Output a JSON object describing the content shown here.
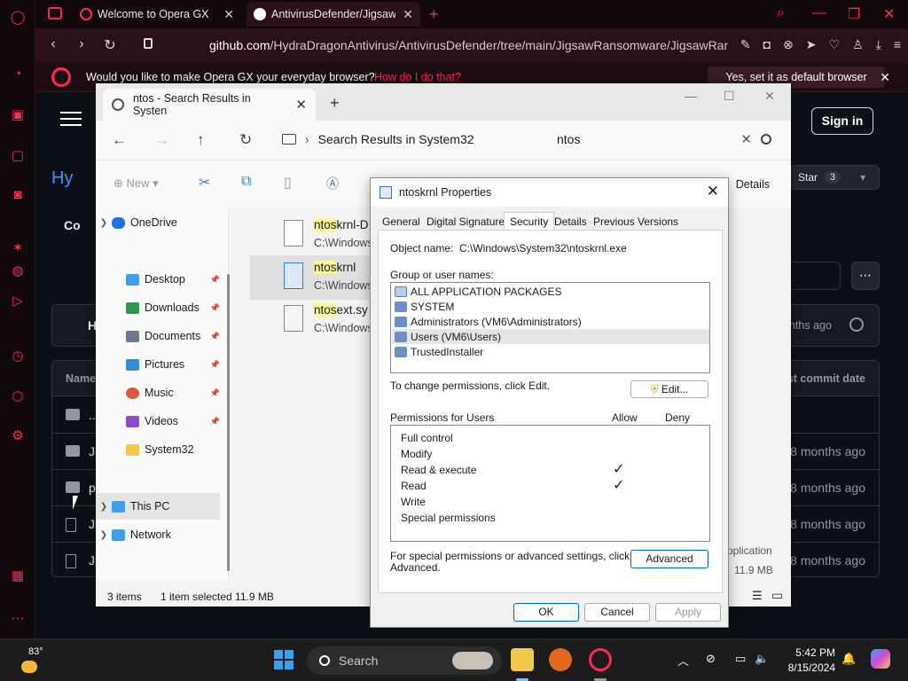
{
  "browser": {
    "tabs": [
      {
        "label": "Welcome to Opera GX"
      },
      {
        "label": "AntivirusDefender/JigsawR"
      }
    ],
    "url_host": "github.com",
    "url_path": "/HydraDragonAntivirus/AntivirusDefender/tree/main/JigsawRansomware/JigsawRansomwa",
    "infobar": {
      "question": "Would you like to make Opera GX your everyday browser?",
      "how_link": "How do I do that?",
      "set_default": "Yes, set it as default browser"
    },
    "accent_color": "#ff2a4f"
  },
  "github": {
    "sign_in": "Sign in",
    "repo_title_visible": "Hy",
    "code_tab_visible": "Co",
    "star_label": "Star",
    "star_count": "3",
    "commit_author_visible": "H",
    "commit_ago": "nths ago",
    "table_header_name": "Name",
    "table_header_date": "ast commit date",
    "rows": [
      {
        "name": "..",
        "age": ""
      },
      {
        "name": "Ji",
        "age": "8 months ago"
      },
      {
        "name": "p",
        "age": "8 months ago"
      },
      {
        "name": "Ji",
        "age": "8 months ago"
      },
      {
        "name": "Ji",
        "age": "8 months ago"
      }
    ]
  },
  "explorer": {
    "tab_title": "ntos - Search Results in Systen",
    "breadcrumb": "Search Results in System32",
    "search_value": "ntos",
    "toolbar_new": "New",
    "toolbar_details": "Details",
    "sidebar": [
      {
        "label": "OneDrive",
        "color": "#1a73e8"
      },
      {
        "label": "Desktop",
        "color": "#3aa0f3"
      },
      {
        "label": "Downloads",
        "color": "#2d9a4b"
      },
      {
        "label": "Documents",
        "color": "#6b7a90"
      },
      {
        "label": "Pictures",
        "color": "#2f8ed8"
      },
      {
        "label": "Music",
        "color": "#e0553a"
      },
      {
        "label": "Videos",
        "color": "#8a4bd1"
      },
      {
        "label": "System32",
        "color": "#f2c94c"
      },
      {
        "label": "This PC",
        "color": "#3aa0f3"
      },
      {
        "label": "Network",
        "color": "#3aa0f3"
      }
    ],
    "files": [
      {
        "highlight": "ntos",
        "rest": "krnl-D",
        "path": "C:\\Windows"
      },
      {
        "highlight": "ntos",
        "rest": "krnl",
        "path": "C:\\Windows"
      },
      {
        "highlight": "ntos",
        "rest": "ext.sy",
        "path": "C:\\Windows"
      }
    ],
    "status_items": "3 items",
    "status_selected": "1 item selected  11.9 MB",
    "right_type": "pplication",
    "right_size": "11.9 MB"
  },
  "properties": {
    "title": "ntoskrnl Properties",
    "tabs": [
      "General",
      "Digital Signatures",
      "Security",
      "Details",
      "Previous Versions"
    ],
    "object_name_label": "Object name:",
    "object_name_value": "C:\\Windows\\System32\\ntoskrnl.exe",
    "group_label": "Group or user names:",
    "groups": [
      "ALL APPLICATION PACKAGES",
      "SYSTEM",
      "Administrators (VM6\\Administrators)",
      "Users (VM6\\Users)",
      "TrustedInstaller"
    ],
    "change_perm_text": "To change permissions, click Edit.",
    "edit_button": "Edit...",
    "perm_for_label": "Permissions for Users",
    "allow_label": "Allow",
    "deny_label": "Deny",
    "permissions": [
      {
        "name": "Full control",
        "allow": ""
      },
      {
        "name": "Modify",
        "allow": ""
      },
      {
        "name": "Read & execute",
        "allow": "✓"
      },
      {
        "name": "Read",
        "allow": "✓"
      },
      {
        "name": "Write",
        "allow": ""
      },
      {
        "name": "Special permissions",
        "allow": ""
      }
    ],
    "advanced_text_line1": "For special permissions or advanced settings, click",
    "advanced_text_line2": "Advanced.",
    "advanced_button": "Advanced",
    "ok_button": "OK",
    "cancel_button": "Cancel",
    "apply_button": "Apply"
  },
  "taskbar": {
    "temperature": "83°",
    "search_label": "Search",
    "time": "5:42 PM",
    "date": "8/15/2024"
  }
}
